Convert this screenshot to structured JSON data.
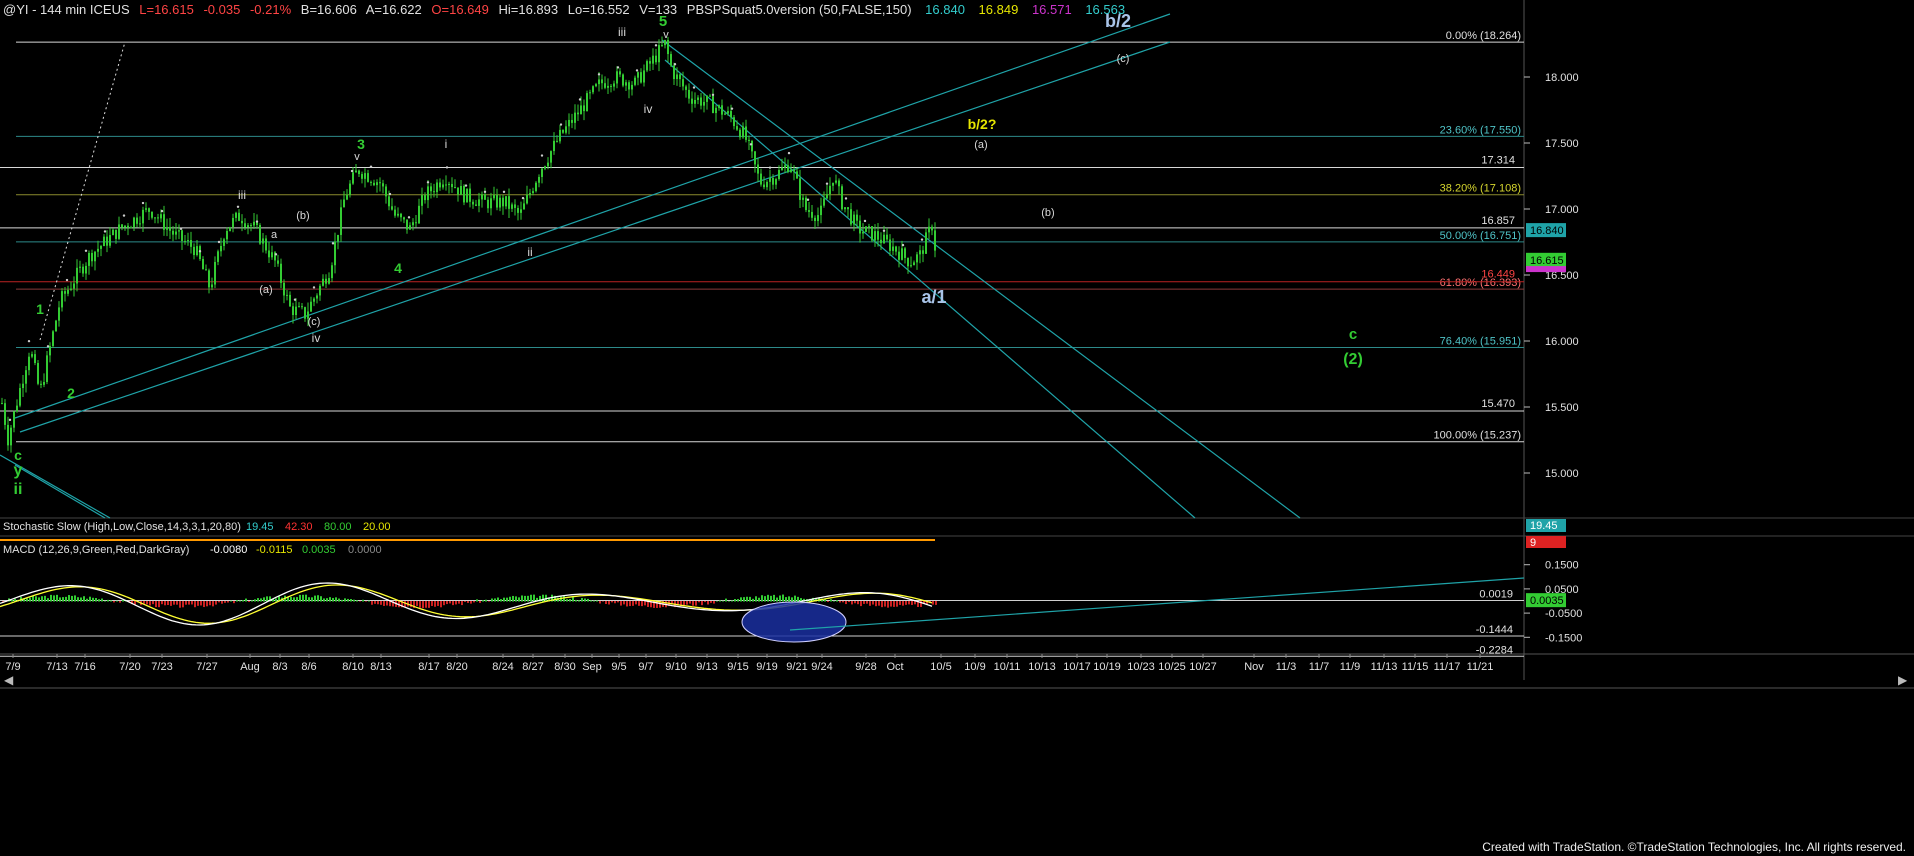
{
  "header": {
    "symbol": "@YI - 144 min  ICEUS",
    "last": "L=16.615",
    "change": "-0.035",
    "pct": "-0.21%",
    "bid": "B=16.606",
    "ask": "A=16.622",
    "open": "O=16.649",
    "hi": "Hi=16.893",
    "lo": "Lo=16.552",
    "vol": "V=133",
    "study": "PBSPSquat5.0version (50,FALSE,150)",
    "study_values": [
      "16.840",
      "16.849",
      "16.571",
      "16.563"
    ]
  },
  "colors": {
    "bg": "#000000",
    "candle": "#33cc33",
    "channel": "#1fa3a8",
    "fib": "#2d8a8a",
    "white_level": "#d8d8d8",
    "green_label": "#33cc33",
    "yellow_label": "#e6e600",
    "wave_white": "#d8d8d8",
    "wave_blue": "#a9c4e8",
    "red": "#ff3333",
    "stoch_k": "#ff9900",
    "macd": "#ffffff",
    "macd_avg": "#ffff33"
  },
  "chart_data": {
    "type": "candlestick",
    "y_axis": {
      "min": 14.5,
      "max": 18.5,
      "ticks": [
        "18.000",
        "17.500",
        "17.000",
        "16.500",
        "16.000",
        "15.500",
        "15.000"
      ]
    },
    "x_axis_labels": [
      "7/9",
      "7/13",
      "7/16",
      "7/20",
      "7/23",
      "7/27",
      "Aug",
      "8/3",
      "8/6",
      "8/10",
      "8/13",
      "8/17",
      "8/20",
      "8/24",
      "8/27",
      "8/30",
      "Sep",
      "9/5",
      "9/7",
      "9/10",
      "9/13",
      "9/15",
      "9/19",
      "9/21",
      "9/24",
      "9/28",
      "Oct",
      "10/5",
      "10/9",
      "10/11",
      "10/13",
      "10/17",
      "10/19",
      "10/23",
      "10/25",
      "10/27",
      "Nov",
      "11/3",
      "11/7",
      "11/9",
      "11/13",
      "11/15",
      "11/17",
      "11/21"
    ],
    "price_path_anchors": [
      [
        0,
        15.62
      ],
      [
        8,
        15.26
      ],
      [
        30,
        15.95
      ],
      [
        40,
        15.6
      ],
      [
        60,
        16.3
      ],
      [
        90,
        16.65
      ],
      [
        120,
        16.85
      ],
      [
        150,
        17.0
      ],
      [
        175,
        16.8
      ],
      [
        195,
        16.7
      ],
      [
        210,
        16.4
      ],
      [
        225,
        16.85
      ],
      [
        240,
        16.95
      ],
      [
        255,
        16.85
      ],
      [
        275,
        16.6
      ],
      [
        290,
        16.25
      ],
      [
        305,
        16.2
      ],
      [
        330,
        16.55
      ],
      [
        345,
        17.1
      ],
      [
        358,
        17.3
      ],
      [
        380,
        17.2
      ],
      [
        395,
        16.95
      ],
      [
        410,
        16.85
      ],
      [
        425,
        17.1
      ],
      [
        445,
        17.25
      ],
      [
        465,
        17.1
      ],
      [
        485,
        17.05
      ],
      [
        505,
        17.05
      ],
      [
        520,
        16.95
      ],
      [
        540,
        17.3
      ],
      [
        560,
        17.55
      ],
      [
        580,
        17.75
      ],
      [
        600,
        17.95
      ],
      [
        615,
        18.0
      ],
      [
        635,
        17.95
      ],
      [
        650,
        18.1
      ],
      [
        665,
        18.25
      ],
      [
        672,
        18.05
      ],
      [
        690,
        17.85
      ],
      [
        710,
        17.8
      ],
      [
        730,
        17.7
      ],
      [
        745,
        17.55
      ],
      [
        760,
        17.2
      ],
      [
        775,
        17.25
      ],
      [
        790,
        17.35
      ],
      [
        805,
        17.0
      ],
      [
        820,
        16.95
      ],
      [
        833,
        17.25
      ],
      [
        842,
        17.05
      ],
      [
        858,
        16.85
      ],
      [
        875,
        16.8
      ],
      [
        895,
        16.7
      ],
      [
        910,
        16.6
      ],
      [
        920,
        16.65
      ],
      [
        933,
        16.9
      ],
      [
        936,
        16.62
      ]
    ],
    "fib_levels": [
      {
        "label": "0.00% (18.264)",
        "value": 18.264
      },
      {
        "label": "23.60% (17.550)",
        "value": 17.55
      },
      {
        "label": "38.20% (17.108)",
        "value": 17.108
      },
      {
        "label": "50.00% (16.751)",
        "value": 16.751
      },
      {
        "label": "61.80% (16.393)",
        "value": 16.393
      },
      {
        "label": "76.40% (15.951)",
        "value": 15.951
      },
      {
        "label": "100.00% (15.237)",
        "value": 15.237
      }
    ],
    "horizontal_levels": [
      {
        "label": "17.314",
        "value": 17.314
      },
      {
        "label": "16.857",
        "value": 16.857
      },
      {
        "label": "15.470",
        "value": 15.47
      },
      {
        "label": "16.449",
        "value": 16.449
      }
    ],
    "price_tags": [
      {
        "label": "16.840",
        "value": 16.84,
        "color": "#1fa3a8",
        "text": "#000000"
      },
      {
        "label": "16.615",
        "value": 16.615,
        "color": "#33cc33",
        "text": "#000000"
      }
    ],
    "wave_labels": [
      {
        "text": "5",
        "color": "green_label",
        "x": 663,
        "y": 26,
        "size": 15
      },
      {
        "text": "v",
        "color": "wave_white",
        "x": 666,
        "y": 38,
        "size": 11
      },
      {
        "text": "iii",
        "color": "wave_white",
        "x": 622,
        "y": 36,
        "size": 12
      },
      {
        "text": "iv",
        "color": "wave_white",
        "x": 648,
        "y": 113,
        "size": 12
      },
      {
        "text": "b/2",
        "color": "wave_blue",
        "x": 1118,
        "y": 27,
        "size": 18
      },
      {
        "text": "(c)",
        "color": "wave_white",
        "x": 1123,
        "y": 62,
        "size": 11
      },
      {
        "text": "b/2?",
        "color": "yellow_label",
        "x": 982,
        "y": 129,
        "size": 14
      },
      {
        "text": "(a)",
        "color": "wave_white",
        "x": 981,
        "y": 148,
        "size": 11
      },
      {
        "text": "(b)",
        "color": "wave_white",
        "x": 1048,
        "y": 216,
        "size": 11
      },
      {
        "text": "a/1",
        "color": "wave_blue",
        "x": 934,
        "y": 303,
        "size": 18
      },
      {
        "text": "c",
        "color": "green_label",
        "x": 1353,
        "y": 339,
        "size": 15
      },
      {
        "text": "(2)",
        "color": "green_label",
        "x": 1353,
        "y": 364,
        "size": 16
      },
      {
        "text": "3",
        "color": "green_label",
        "x": 361,
        "y": 149,
        "size": 14
      },
      {
        "text": "v",
        "color": "wave_white",
        "x": 357,
        "y": 160,
        "size": 11
      },
      {
        "text": "i",
        "color": "wave_white",
        "x": 446,
        "y": 148,
        "size": 12
      },
      {
        "text": "ii",
        "color": "wave_white",
        "x": 530,
        "y": 256,
        "size": 12
      },
      {
        "text": "4",
        "color": "green_label",
        "x": 398,
        "y": 273,
        "size": 14
      },
      {
        "text": "iii",
        "color": "wave_white",
        "x": 242,
        "y": 199,
        "size": 12
      },
      {
        "text": "(b)",
        "color": "wave_white",
        "x": 303,
        "y": 219,
        "size": 11
      },
      {
        "text": "a",
        "color": "wave_white",
        "x": 274,
        "y": 238,
        "size": 11
      },
      {
        "text": "(a)",
        "color": "wave_white",
        "x": 266,
        "y": 293,
        "size": 11
      },
      {
        "text": "(c)",
        "color": "wave_white",
        "x": 314,
        "y": 325,
        "size": 11
      },
      {
        "text": "iv",
        "color": "wave_white",
        "x": 316,
        "y": 342,
        "size": 12
      },
      {
        "text": "1",
        "color": "green_label",
        "x": 40,
        "y": 314,
        "size": 14
      },
      {
        "text": "2",
        "color": "green_label",
        "x": 71,
        "y": 398,
        "size": 14
      },
      {
        "text": "c",
        "color": "green_label",
        "x": 18,
        "y": 460,
        "size": 14
      },
      {
        "text": "y",
        "color": "green_label",
        "x": 18,
        "y": 475,
        "size": 16
      },
      {
        "text": "ii",
        "color": "green_label",
        "x": 18,
        "y": 494,
        "size": 16
      }
    ],
    "stochastic": {
      "title": "Stochastic Slow (High,Low,Close,14,3,3,1,20,80)",
      "values": [
        "19.45",
        "42.30",
        "80.00",
        "20.00"
      ],
      "right_tags": [
        "19.45",
        "9"
      ]
    },
    "macd": {
      "title": "MACD (12,26,9,Green,Red,DarkGray)",
      "values": [
        "-0.0080",
        "-0.0115",
        "0.0035",
        "0.0000"
      ],
      "y_ticks": [
        "0.1500",
        "0.0500",
        "-0.0500",
        "-0.1500"
      ],
      "levels": [
        {
          "label": "0.0019",
          "value": 0.0019
        },
        {
          "label": "-0.1444",
          "value": -0.1444
        },
        {
          "label": "-0.2284",
          "value": -0.2284
        }
      ],
      "tag": "0.0035",
      "range": [
        -0.24,
        0.22
      ]
    }
  },
  "footer": {
    "text": "Created with TradeStation. ©TradeStation Technologies, Inc. All rights reserved."
  }
}
